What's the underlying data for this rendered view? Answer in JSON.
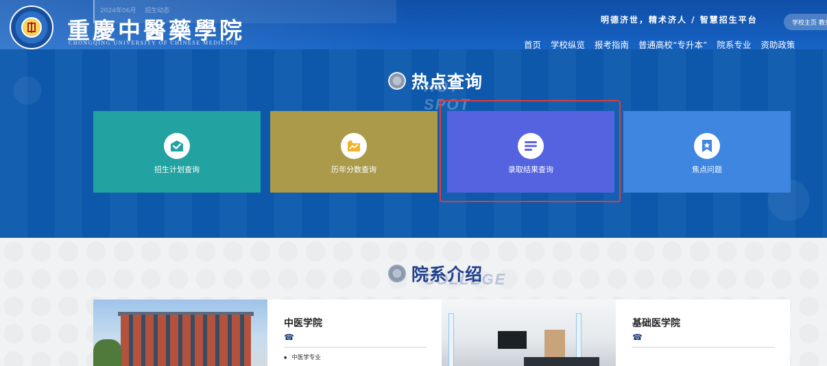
{
  "header": {
    "ghost_news_date": "2024年06月",
    "ghost_news_tag": "招生动态",
    "school_name_cn": "重慶中醫藥學院",
    "school_name_en": "CHONGQING UNIVERSITY OF CHINESE MEDICINE",
    "slogan": "明德济世，精术济人 / 智慧招生平台",
    "home_link": "学校主页 教务",
    "nav": [
      "首页",
      "学校纵览",
      "报考指南",
      "普通高校“专升本”",
      "院系专业",
      "资助政策"
    ]
  },
  "hot_query": {
    "title": "热点查询",
    "title_en": "HOT SPOT",
    "cards": [
      {
        "label": "招生计划查询",
        "icon": "envelope-check-icon",
        "color": "#22a2a0"
      },
      {
        "label": "历年分数查询",
        "icon": "folder-chart-icon",
        "color": "#ab9a4a"
      },
      {
        "label": "录取结果查询",
        "icon": "list-lines-icon",
        "color": "#5563e1"
      },
      {
        "label": "焦点问题",
        "icon": "bookmark-star-icon",
        "color": "#3e86e0"
      }
    ]
  },
  "departments": {
    "title": "院系介绍",
    "title_en": "COLLEGE",
    "items": [
      {
        "name": "中医学院",
        "phone_icon": "phone-icon",
        "major": "中医学专业"
      },
      {
        "name": "基础医学院",
        "phone_icon": "phone-icon",
        "major": ""
      }
    ]
  },
  "highlight_color": "#e53935"
}
